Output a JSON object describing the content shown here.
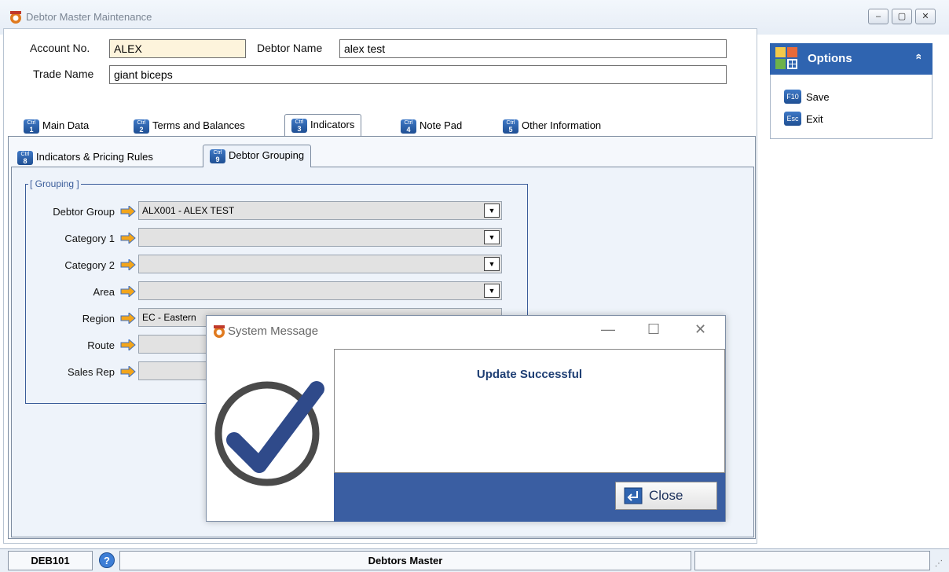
{
  "window": {
    "title": "Debtor Master Maintenance",
    "minimize_glyph": "–",
    "restore_glyph": "▢",
    "close_glyph": "✕"
  },
  "header": {
    "account_label": "Account No.",
    "account_value": "ALEX",
    "debtor_name_label": "Debtor Name",
    "debtor_name_value": "alex test",
    "trade_name_label": "Trade Name",
    "trade_name_value": "giant biceps"
  },
  "tabs": [
    {
      "key": "1",
      "label": "Main Data"
    },
    {
      "key": "2",
      "label": "Terms and Balances"
    },
    {
      "key": "3",
      "label": "Indicators"
    },
    {
      "key": "4",
      "label": "Note Pad"
    },
    {
      "key": "5",
      "label": "Other Information"
    }
  ],
  "subtabs": [
    {
      "key": "8",
      "label": "Indicators & Pricing Rules"
    },
    {
      "key": "9",
      "label": "Debtor Grouping"
    }
  ],
  "ctrl_label": "Ctrl",
  "grouping": {
    "title": "[ Grouping ]",
    "rows": [
      {
        "label": "Debtor Group",
        "value": "ALX001 - ALEX TEST"
      },
      {
        "label": "Category 1",
        "value": ""
      },
      {
        "label": "Category 2",
        "value": ""
      },
      {
        "label": "Area",
        "value": ""
      },
      {
        "label": "Region",
        "value": "EC - Eastern"
      },
      {
        "label": "Route",
        "value": ""
      },
      {
        "label": "Sales Rep",
        "value": ""
      }
    ]
  },
  "options": {
    "title": "Options",
    "collapse_glyph": "»",
    "items": [
      {
        "key": "F10",
        "label": "Save"
      },
      {
        "key": "Esc",
        "label": "Exit"
      }
    ]
  },
  "statusbar": {
    "code": "DEB101",
    "help_glyph": "?",
    "module": "Debtors Master"
  },
  "dialog": {
    "title": "System Message",
    "message": "Update Successful",
    "close_label": "Close",
    "minimize_glyph": "—",
    "maximize_glyph": "☐",
    "close_glyph": "✕"
  },
  "colors": {
    "accent": "#2f64b0",
    "dialog_band": "#3a5ea2",
    "account_field": "#fdf4dc"
  }
}
